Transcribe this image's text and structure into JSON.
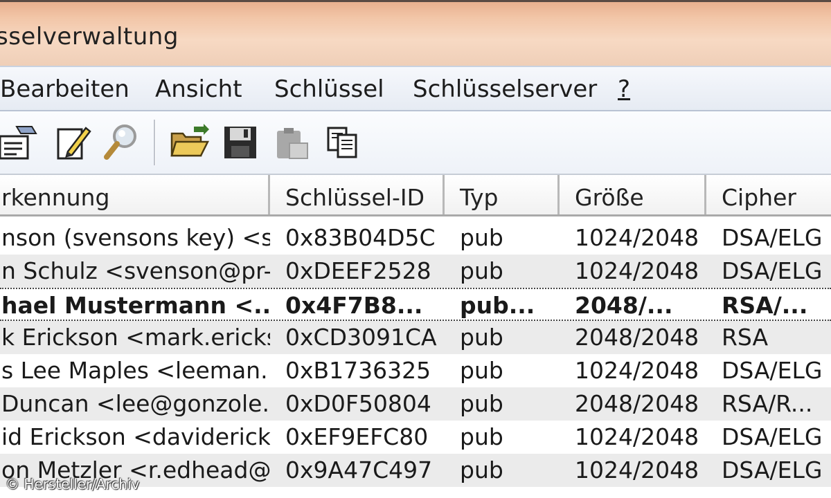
{
  "window": {
    "title": "sselverwaltung"
  },
  "menu": {
    "items": [
      "Bearbeiten",
      "Ansicht",
      "Schlüssel",
      "Schlüsselserver",
      "?"
    ]
  },
  "toolbar": {
    "icons": [
      "key-properties-icon",
      "edit-key-icon",
      "search-key-icon",
      "open-folder-icon",
      "save-icon",
      "paste-icon",
      "copy-icon"
    ]
  },
  "table": {
    "columns": [
      "rkennung",
      "Schlüssel-ID",
      "Typ",
      "Größe",
      "Cipher"
    ],
    "rows": [
      {
        "name": "nson (svensons key) <s...",
        "id": "0x83B04D5C",
        "typ": "pub",
        "size": "1024/2048",
        "cipher": "DSA/ELG"
      },
      {
        "name": "n Schulz <svenson@pr-...",
        "id": "0xDEEF2528",
        "typ": "pub",
        "size": "1024/2048",
        "cipher": "DSA/ELG"
      },
      {
        "name": "hael Mustermann <...",
        "id": "0x4F7B8...",
        "typ": "pub...",
        "size": "2048/...",
        "cipher": "RSA/..."
      },
      {
        "name": "k Erickson <mark.ericks...",
        "id": "0xCD3091CA",
        "typ": "pub",
        "size": "2048/2048",
        "cipher": "RSA"
      },
      {
        "name": "s Lee Maples <leeman...",
        "id": "0xB1736325",
        "typ": "pub",
        "size": "1024/2048",
        "cipher": "DSA/ELG"
      },
      {
        "name": "Duncan <lee@gonzole...",
        "id": "0xD0F50804",
        "typ": "pub",
        "size": "2048/2048",
        "cipher": "RSA/R..."
      },
      {
        "name": "id Erickson <daviderick...",
        "id": "0xEF9EFC80",
        "typ": "pub",
        "size": "1024/2048",
        "cipher": "DSA/ELG"
      },
      {
        "name": "on Metzler <r.edhead@li...",
        "id": "0x9A47C497",
        "typ": "pub",
        "size": "1024/2048",
        "cipher": "DSA/ELG"
      }
    ]
  },
  "watermark": "© Hersteller/Archiv"
}
